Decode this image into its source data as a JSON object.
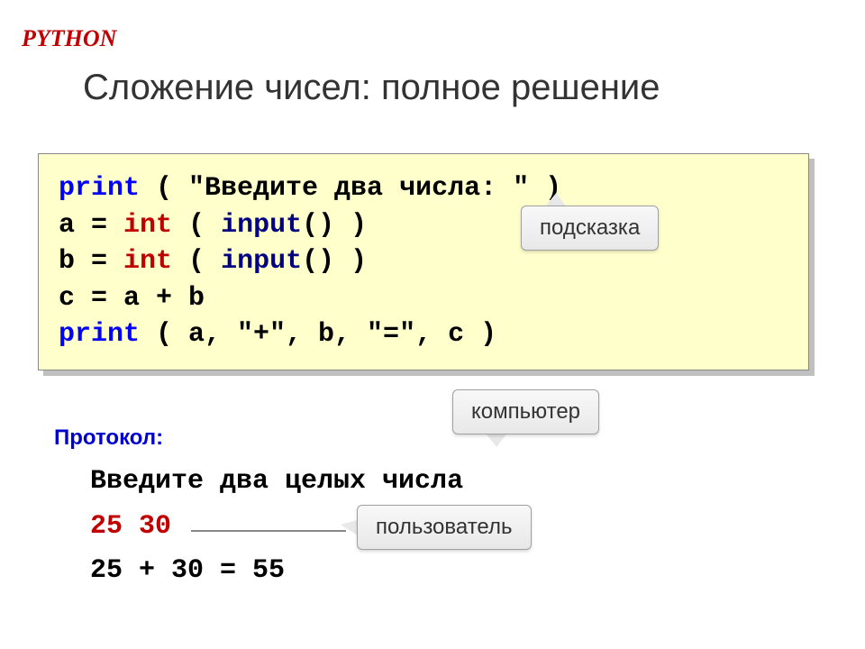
{
  "header": {
    "label": "PYTHON",
    "title": "Сложение чисел: полное решение"
  },
  "code": {
    "line1_kw": "print",
    "line1_rest": " ( \"Введите два числа: \" )",
    "line2_a": "a",
    "line2_eq": " = ",
    "line2_int": "int",
    "line2_paren_open": " ( ",
    "line2_input": "input",
    "line2_paren_close": "() )",
    "line3_a": "b",
    "line3_eq": " = ",
    "line3_int": "int",
    "line3_paren_open": " ( ",
    "line3_input": "input",
    "line3_paren_close": "() )",
    "line4": "c = a + b",
    "line5_kw": "print",
    "line5_rest": " ( a, \"+\", b, \"=\", c )"
  },
  "callouts": {
    "hint": "подсказка",
    "computer": "компьютер",
    "user": "пользователь"
  },
  "protocol": {
    "label": "Протокол:",
    "line1": "Введите два целых числа",
    "line2": "25 30",
    "line3": "25 + 30 = 55"
  }
}
